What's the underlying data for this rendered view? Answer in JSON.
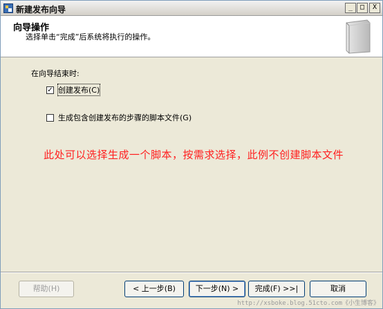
{
  "window": {
    "title": "新建发布向导",
    "caption_buttons": {
      "minimize": "_",
      "maximize": "□",
      "close": "X"
    }
  },
  "header": {
    "title": "向导操作",
    "subtitle": "选择单击“完成”后系统将执行的操作。"
  },
  "body": {
    "section_label": "在向导结束时:",
    "options": [
      {
        "label": "创建发布(C)",
        "checked": true
      },
      {
        "label": "生成包含创建发布的步骤的脚本文件(G)",
        "checked": false
      }
    ],
    "annotation": "此处可以选择生成一个脚本，按需求选择，此例不创建脚本文件"
  },
  "footer": {
    "help": "帮助(H)",
    "back": "< 上一步(B)",
    "next": "下一步(N) >",
    "finish": "完成(F) >>|",
    "cancel": "取消"
  },
  "watermark": "http://xsboke.blog.51cto.com《小生博客》"
}
